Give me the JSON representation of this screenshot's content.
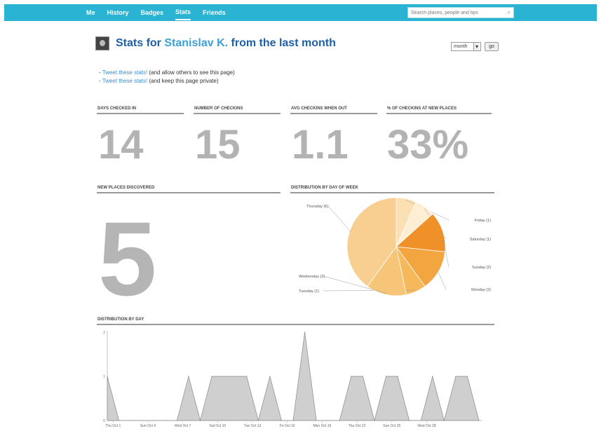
{
  "nav": {
    "items": [
      {
        "label": "Me",
        "active": false
      },
      {
        "label": "History",
        "active": false
      },
      {
        "label": "Badges",
        "active": false
      },
      {
        "label": "Stats",
        "active": true
      },
      {
        "label": "Friends",
        "active": false
      }
    ],
    "search_placeholder": "Search places, people and tips",
    "search_button": "⌕"
  },
  "header": {
    "title_prefix": "Stats for",
    "user_name": "Stanislav K.",
    "title_suffix": "from the last month",
    "period_selected": "month",
    "go_label": "go"
  },
  "tweets": [
    {
      "link": "Tweet these stats!",
      "note": "(and allow others to see this page)"
    },
    {
      "link": "Tweet these stats!",
      "note": "(and keep this page private)"
    }
  ],
  "stats": [
    {
      "label": "Days checked in",
      "value": "14"
    },
    {
      "label": "Number of checkins",
      "value": "15"
    },
    {
      "label": "Avg checkins when out",
      "value": "1.1"
    },
    {
      "label": "% of checkins at new places",
      "value": "33%"
    }
  ],
  "new_places": {
    "label": "New places discovered",
    "value": "5"
  },
  "pie": {
    "label": "Distribution by day of week",
    "slices": [
      {
        "name": "Thursday",
        "value": 6,
        "color": "#f9cf91",
        "label": "Thursday (6)"
      },
      {
        "name": "Friday",
        "value": 1,
        "color": "#fbe0b4",
        "label": "Friday (1)"
      },
      {
        "name": "Saturday",
        "value": 1,
        "color": "#fdeed4",
        "label": "Saturday (1)"
      },
      {
        "name": "Sunday",
        "value": 2,
        "color": "#ef9128",
        "label": "Sunday (2)"
      },
      {
        "name": "Monday",
        "value": 2,
        "color": "#f3a640",
        "label": "Monday (2)"
      },
      {
        "name": "Tuesday",
        "value": 1,
        "color": "#f5b95c",
        "label": "Tuesday (1)"
      },
      {
        "name": "Wednesday",
        "value": 2,
        "color": "#f7c577",
        "label": "Wednesday (2)"
      }
    ]
  },
  "chart_data": {
    "type": "area",
    "title": "Distribution by day",
    "ylim": [
      0,
      2
    ],
    "yticks": [
      "2",
      "1",
      "0"
    ],
    "x_labels": [
      "Thu Oct 1",
      "Sun Oct 4",
      "Wed Oct 7",
      "Sat Oct 10",
      "Tue Oct 13",
      "Fri Oct 16",
      "Mon Oct 19",
      "Thu Oct 22",
      "Sun Oct 25",
      "Wed Oct 28"
    ],
    "values": [
      1,
      0,
      0,
      0,
      0,
      0,
      0,
      1,
      0,
      1,
      1,
      1,
      1,
      0,
      1,
      0,
      0,
      2,
      0,
      0,
      0,
      1,
      1,
      0,
      1,
      1,
      0,
      0,
      1,
      0,
      1,
      1,
      0
    ]
  }
}
